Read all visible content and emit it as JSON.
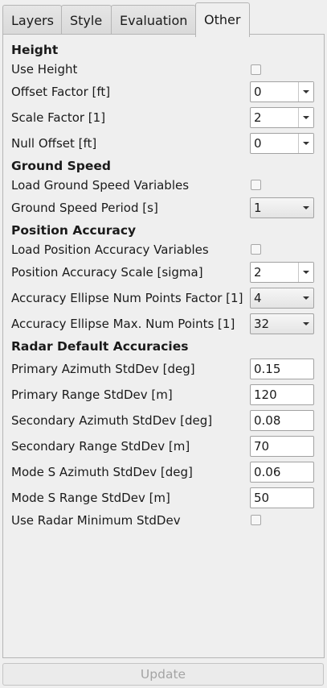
{
  "tabs": [
    {
      "label": "Layers"
    },
    {
      "label": "Style"
    },
    {
      "label": "Evaluation"
    },
    {
      "label": "Other"
    }
  ],
  "height": {
    "heading": "Height",
    "use_height_label": "Use Height",
    "use_height_checked": false,
    "offset_factor_label": "Offset Factor [ft]",
    "offset_factor_value": "0",
    "scale_factor_label": "Scale Factor [1]",
    "scale_factor_value": "2",
    "null_offset_label": "Null Offset [ft]",
    "null_offset_value": "0"
  },
  "ground_speed": {
    "heading": "Ground Speed",
    "load_label": "Load Ground Speed Variables",
    "load_checked": false,
    "period_label": "Ground Speed Period [s]",
    "period_value": "1"
  },
  "position_accuracy": {
    "heading": "Position Accuracy",
    "load_label": "Load Position Accuracy Variables",
    "load_checked": false,
    "scale_label": "Position Accuracy Scale [sigma]",
    "scale_value": "2",
    "num_points_factor_label": "Accuracy Ellipse Num Points Factor [1]",
    "num_points_factor_value": "4",
    "max_num_points_label": "Accuracy Ellipse Max. Num Points [1]",
    "max_num_points_value": "32"
  },
  "radar": {
    "heading": "Radar Default Accuracies",
    "primary_azimuth_label": "Primary Azimuth StdDev [deg]",
    "primary_azimuth_value": "0.15",
    "primary_range_label": "Primary Range StdDev [m]",
    "primary_range_value": "120",
    "secondary_azimuth_label": "Secondary Azimuth StdDev [deg]",
    "secondary_azimuth_value": "0.08",
    "secondary_range_label": "Secondary Range StdDev [m]",
    "secondary_range_value": "70",
    "modes_azimuth_label": "Mode S Azimuth StdDev [deg]",
    "modes_azimuth_value": "0.06",
    "modes_range_label": "Mode S Range StdDev [m]",
    "modes_range_value": "50",
    "use_min_label": "Use Radar Minimum StdDev",
    "use_min_checked": false
  },
  "footer": {
    "update_label": "Update",
    "update_enabled": false
  }
}
